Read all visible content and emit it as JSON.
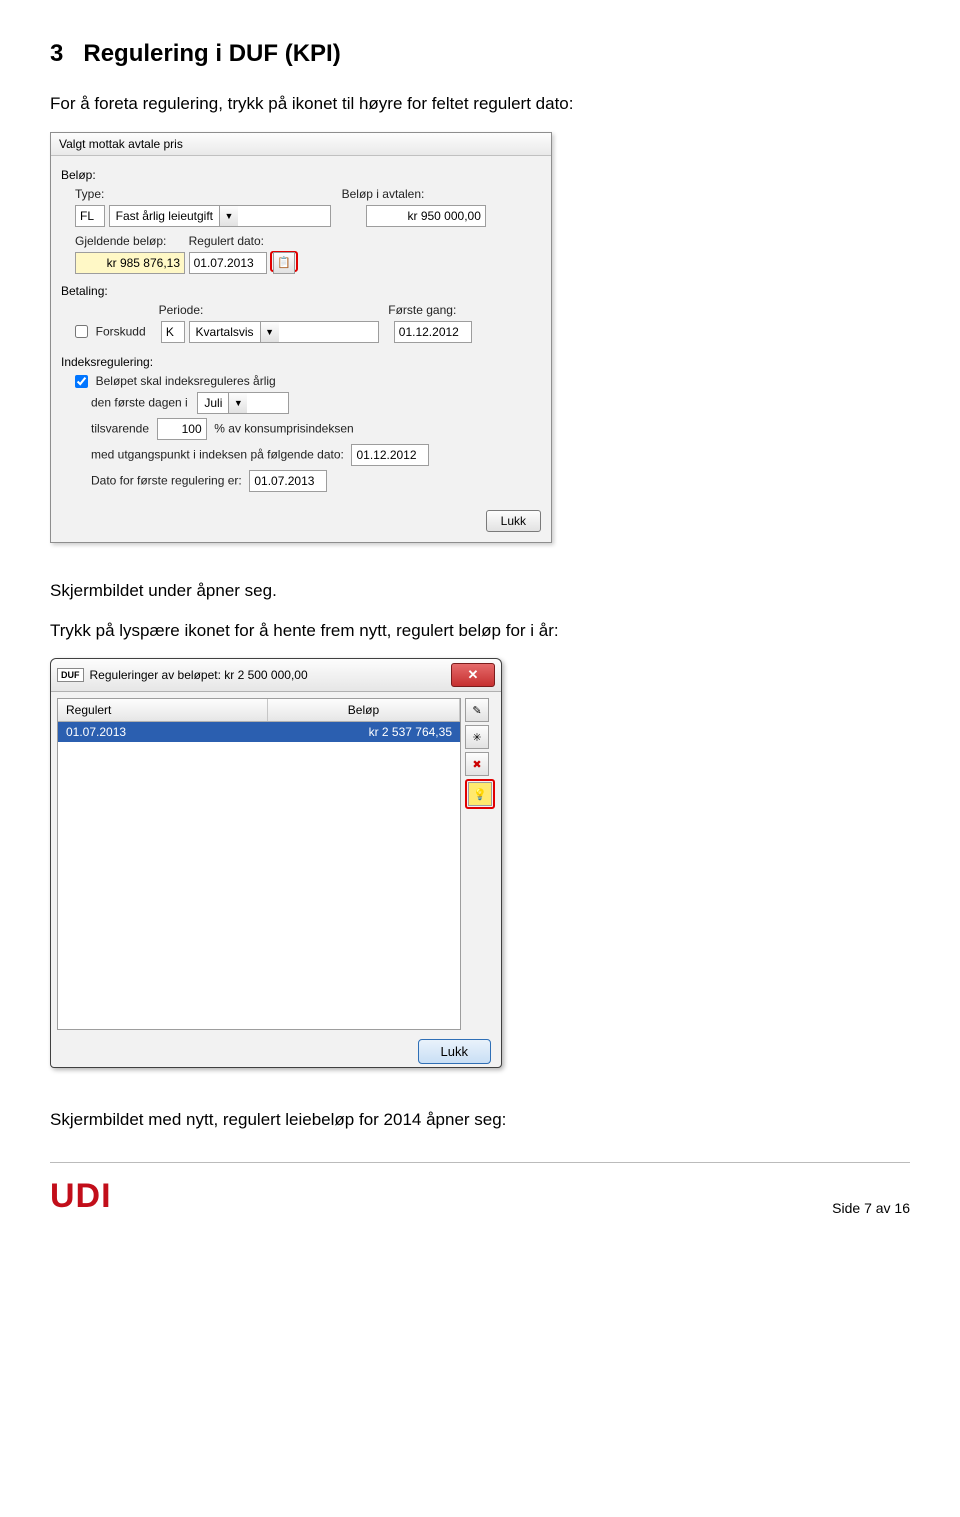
{
  "heading_num": "3",
  "heading_text": "Regulering i DUF (KPI)",
  "intro_p1": "For å foreta regulering, trykk på ikonet til høyre for feltet regulert dato:",
  "win1": {
    "title": "Valgt mottak avtale pris",
    "belop_label": "Beløp:",
    "type_label": "Type:",
    "type_code": "FL",
    "type_value": "Fast årlig leieutgift",
    "belop_i_avtalen_label": "Beløp i avtalen:",
    "belop_i_avtalen_value": "kr 950 000,00",
    "gjeldende_belop_label": "Gjeldende beløp:",
    "gjeldende_belop_value": "kr 985 876,13",
    "regulert_dato_label": "Regulert dato:",
    "regulert_dato_value": "01.07.2013",
    "betaling_label": "Betaling:",
    "forskudd_label": "Forskudd",
    "periode_label": "Periode:",
    "periode_code": "K",
    "periode_value": "Kvartalsvis",
    "forste_gang_label": "Første gang:",
    "forste_gang_value": "01.12.2012",
    "indeksreg_label": "Indeksregulering:",
    "indeks_check_label": "Beløpet skal indeksreguleres årlig",
    "indeks_line1_prefix": "den første dagen i",
    "indeks_line1_month": "Juli",
    "indeks_line2_prefix": "tilsvarende",
    "indeks_line2_value": "100",
    "indeks_line2_suffix": "% av konsumprisindeksen",
    "indeks_line3_prefix": "med utgangspunkt i indeksen på følgende dato:",
    "indeks_line3_value": "01.12.2012",
    "indeks_line4_prefix": "Dato for første regulering er:",
    "indeks_line4_value": "01.07.2013",
    "lukk_label": "Lukk"
  },
  "mid_p1": "Skjermbildet under åpner seg.",
  "mid_p2": "Trykk på lyspære ikonet for å hente frem nytt, regulert beløp for i år:",
  "win2": {
    "title": "Reguleringer av beløpet: kr 2 500 000,00",
    "col_regulert": "Regulert",
    "col_belop": "Beløp",
    "row_date": "01.07.2013",
    "row_amount": "kr 2 537 764,35",
    "lukk_label": "Lukk"
  },
  "outro_p1": "Skjermbildet med nytt, regulert leiebeløp for 2014 åpner seg:",
  "page_footer": "Side 7 av 16",
  "logo_text": "UDI"
}
